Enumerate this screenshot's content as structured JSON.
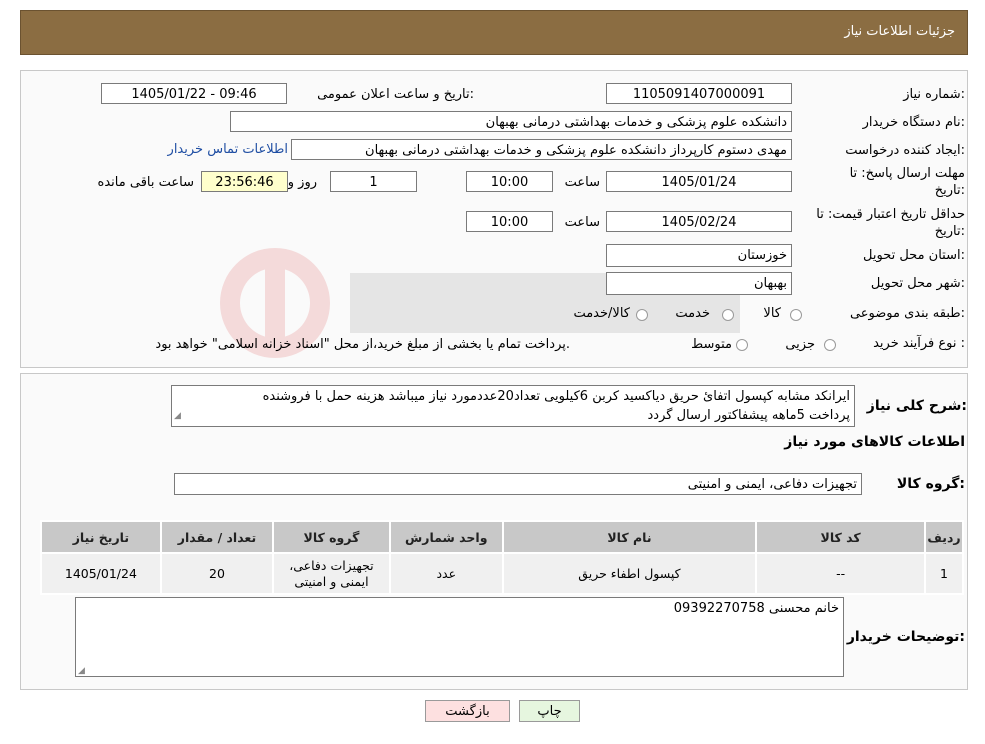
{
  "header": {
    "title": "جزئیات اطلاعات نیاز"
  },
  "info": {
    "need_number_label": "شماره نیاز:",
    "need_number": "1105091407000091",
    "announce_label": "تاریخ و ساعت اعلان عمومی:",
    "announce_value": "1405/01/22 - 09:46",
    "buyer_org_label": "نام دستگاه خریدار:",
    "buyer_org": "دانشکده علوم پزشکی و خدمات بهداشتی  درمانی بهبهان",
    "creator_label": "ایجاد کننده درخواست:",
    "creator": "مهدی دستوم کارپرداز دانشکده علوم پزشکی و خدمات بهداشتی  درمانی بهبهان",
    "contact_link": "اطلاعات تماس خریدار",
    "deadline_label_1": "مهلت ارسال پاسخ: تا",
    "deadline_label_2": "تاریخ:",
    "deadline_date": "1405/01/24",
    "time_label": "ساعت",
    "deadline_time": "10:00",
    "days_value": "1",
    "days_label": "روز و",
    "remaining_time": "23:56:46",
    "remaining_label": "ساعت باقی مانده",
    "price_valid_label_1": "حداقل تاریخ اعتبار قیمت: تا",
    "price_valid_label_2": "تاریخ:",
    "price_valid_date": "1405/02/24",
    "price_valid_time": "10:00",
    "province_label": "استان محل تحویل:",
    "province": "خوزستان",
    "city_label": "شهر محل تحویل:",
    "city": "بهبهان",
    "category_label": "طبقه بندی موضوعی:",
    "category_options": [
      "کالا",
      "خدمت",
      "کالا/خدمت"
    ],
    "process_label": "نوع فرآیند خرید :",
    "process_options": [
      "جزیی",
      "متوسط"
    ],
    "process_note": "پرداخت تمام یا بخشی از مبلغ خرید،از محل \"اسناد خزانه اسلامی\" خواهد بود."
  },
  "description": {
    "label": "شرح کلی نیاز:",
    "text_line1": "ایرانکد مشابه کپسول اتفائ حریق دیاکسید کربن 6کیلویی تعداد20عددمورد نیاز میباشد هزینه حمل با فروشنده",
    "text_line2": "پرداخت 5ماهه  پیشفاکتور ارسال گردد"
  },
  "goods": {
    "section_title": "اطلاعات کالاهای مورد نیاز",
    "group_label": "گروه کالا:",
    "group_value": "تجهیزات دفاعی، ایمنی و امنیتی",
    "columns": [
      "ردیف",
      "کد کالا",
      "نام کالا",
      "واحد شمارش",
      "گروه کالا",
      "تعداد / مقدار",
      "تاریخ نیاز"
    ],
    "rows": [
      {
        "row": "1",
        "code": "--",
        "name": "کپسول اطفاء حریق",
        "unit": "عدد",
        "group": "تجهیزات دفاعی، ایمنی و امنیتی",
        "qty": "20",
        "date": "1405/01/24"
      }
    ]
  },
  "buyer_notes": {
    "label": "توضیحات خریدار:",
    "text": "خانم محسنی 09392270758"
  },
  "buttons": {
    "print": "چاپ",
    "back": "بازگشت"
  },
  "colors": {
    "header_bg": "#8B6D42",
    "link": "#1f4ea3",
    "time_box": "#ffffcc"
  }
}
